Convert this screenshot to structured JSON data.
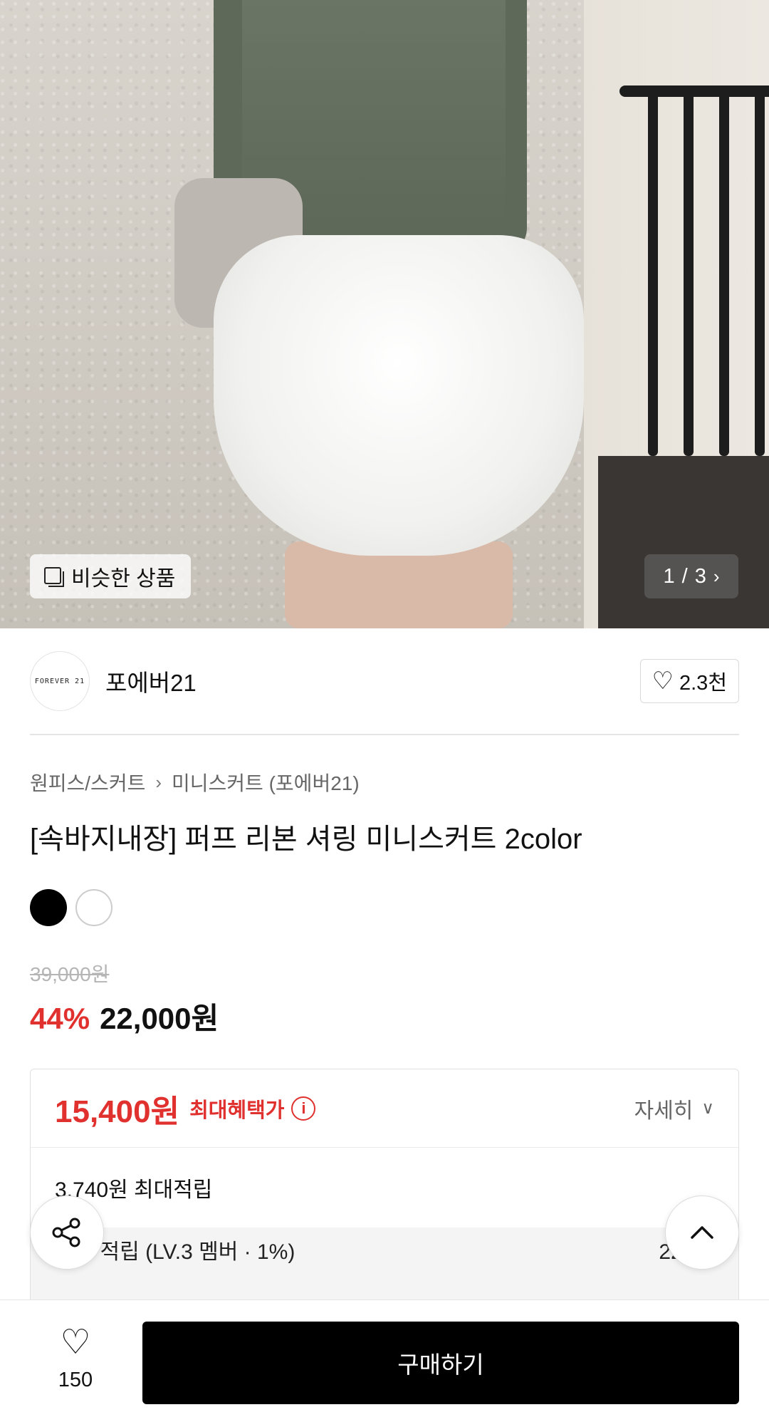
{
  "hero": {
    "similar_label": "비슷한 상품",
    "pager_current": "1",
    "pager_total": "3",
    "pager_separator": " / "
  },
  "brand": {
    "logo_text": "FOREVER 21",
    "name": "포에버21",
    "like_count": "2.3천"
  },
  "breadcrumb": {
    "category": "원피스/스커트",
    "subcategory": "미니스커트 (포에버21)"
  },
  "product": {
    "title": "[속바지내장] 퍼프 리본 셔링 미니스커트 2color",
    "colors": [
      "#000000",
      "#ffffff"
    ],
    "original_price": "39,000원",
    "discount": "44%",
    "sale_price": "22,000원"
  },
  "benefit": {
    "max_price": "15,400원",
    "max_label": "최대혜택가",
    "detail_label": "자세히",
    "points": "3,740원 최대적립",
    "grade_label": "등급 적립 (LV.3 멤버 · 1%)",
    "grade_value": "220원"
  },
  "bottom_bar": {
    "wish_count": "150",
    "buy_label": "구매하기"
  },
  "colors": {
    "accent_red": "#e0312f",
    "buy_button": "#000000"
  }
}
